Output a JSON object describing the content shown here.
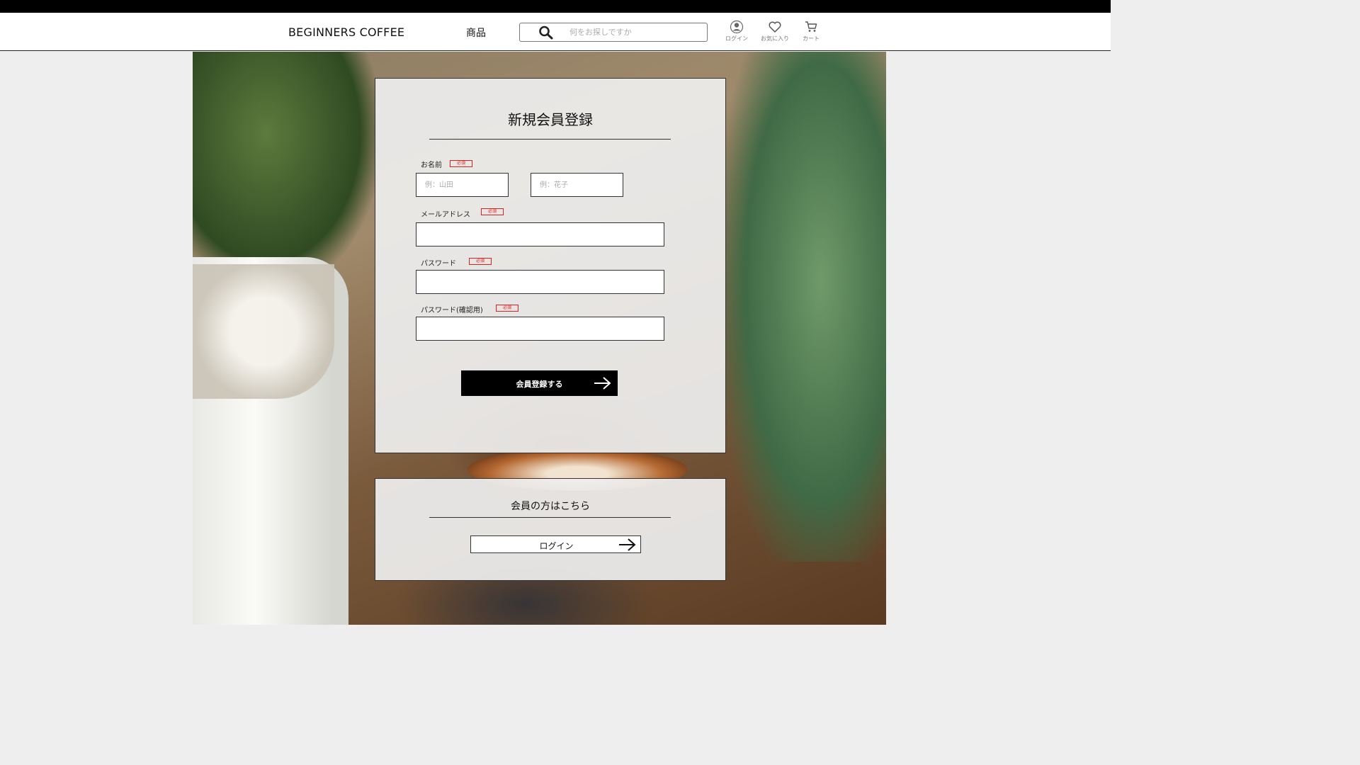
{
  "header": {
    "brand": "BEGINNERS COFFEE",
    "nav_products": "商品",
    "search_placeholder": "何をお探しですか",
    "login_label": "ログイン",
    "favorites_label": "お気に入り",
    "cart_label": "カート"
  },
  "register": {
    "title": "新規会員登録",
    "required_badge": "必須",
    "name_label": "お名前",
    "last_name_placeholder": "例：山田",
    "first_name_placeholder": "例：花子",
    "email_label": "メールアドレス",
    "password_label": "パスワード",
    "password_confirm_label": "パスワード(確認用)",
    "submit_label": "会員登録する"
  },
  "member": {
    "title": "会員の方はこちら",
    "login_button_label": "ログイン"
  },
  "colors": {
    "accent": "#000000",
    "required": "#dd2222",
    "header_bg": "#ffffff",
    "page_bg": "#eeeeee"
  },
  "icons": [
    "search-icon",
    "user-icon",
    "heart-icon",
    "cart-icon",
    "arrow-right-icon"
  ]
}
